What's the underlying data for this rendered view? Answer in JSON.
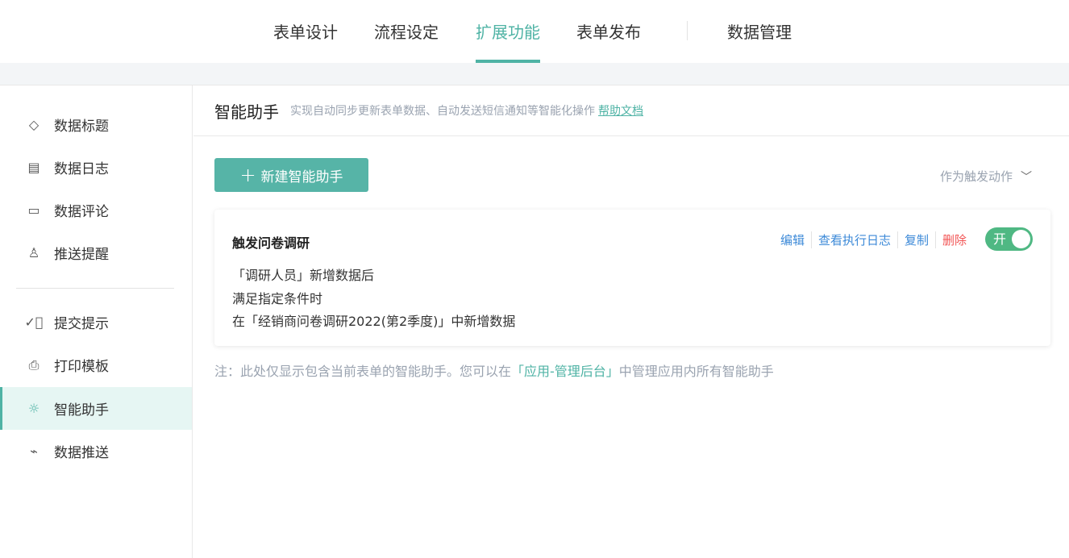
{
  "top_tabs": [
    {
      "label": "表单设计"
    },
    {
      "label": "流程设定"
    },
    {
      "label": "扩展功能",
      "active": true
    },
    {
      "label": "表单发布"
    },
    {
      "label": "数据管理"
    }
  ],
  "sidebar": {
    "items": [
      {
        "label": "数据标题",
        "icon": "tag-icon"
      },
      {
        "label": "数据日志",
        "icon": "log-icon"
      },
      {
        "label": "数据评论",
        "icon": "comment-icon"
      },
      {
        "label": "推送提醒",
        "icon": "bell-icon"
      },
      {
        "label": "提交提示",
        "icon": "check-circle-icon"
      },
      {
        "label": "打印模板",
        "icon": "printer-icon"
      },
      {
        "label": "智能助手",
        "icon": "lightbulb-icon",
        "active": true
      },
      {
        "label": "数据推送",
        "icon": "chart-icon"
      }
    ]
  },
  "header": {
    "title": "智能助手",
    "desc": "实现自动同步更新表单数据、自动发送短信通知等智能化操作",
    "help": "帮助文档"
  },
  "new_button": "新建智能助手",
  "trigger_filter": "作为触发动作",
  "card": {
    "title": "触发问卷调研",
    "lines": [
      "「调研人员」新增数据后",
      "满足指定条件时",
      "在「经销商问卷调研2022(第2季度)」中新增数据"
    ],
    "actions": {
      "edit": "编辑",
      "logs": "查看执行日志",
      "copy": "复制",
      "delete": "删除"
    },
    "toggle": "开",
    "enabled": true
  },
  "note": {
    "prefix": "注：此处仅显示包含当前表单的智能助手。您可以在",
    "link": "「应用-管理后台」",
    "suffix": "中管理应用内所有智能助手"
  }
}
